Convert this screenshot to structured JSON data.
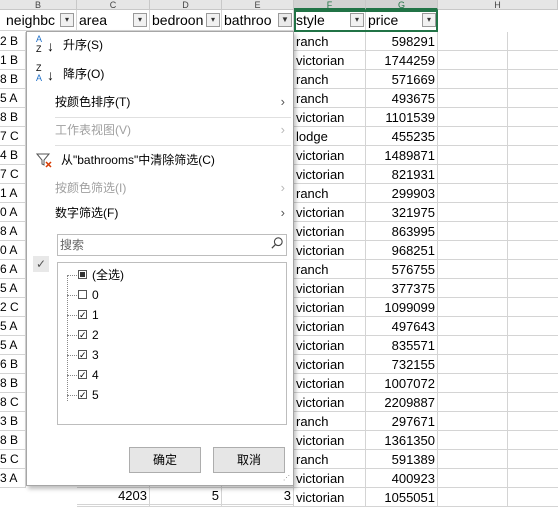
{
  "column_letters": [
    "B",
    "C",
    "D",
    "E",
    "F",
    "G",
    "H"
  ],
  "headers": {
    "neighborhood": "neighbc",
    "area": "area",
    "bedrooms": "bedroon",
    "bathrooms": "bathroo",
    "style": "style",
    "price": "price"
  },
  "row_labels": [
    "2 B",
    "1 B",
    "8 B",
    "5 A",
    "8 B",
    "7 C",
    "4 B",
    "7 C",
    "1 A",
    "0 A",
    "8 A",
    "0 A",
    "6 A",
    "5 A",
    "2 C",
    "5 A",
    "5 A",
    "6 B",
    "8 B",
    "8 C",
    "3 B",
    "8 B",
    "5 C",
    "3 A"
  ],
  "styles": [
    "ranch",
    "victorian",
    "ranch",
    "ranch",
    "victorian",
    "lodge",
    "victorian",
    "victorian",
    "ranch",
    "victorian",
    "victorian",
    "victorian",
    "ranch",
    "victorian",
    "victorian",
    "victorian",
    "victorian",
    "victorian",
    "victorian",
    "victorian",
    "ranch",
    "victorian",
    "ranch",
    "victorian",
    "victorian"
  ],
  "prices": [
    "598291",
    "1744259",
    "571669",
    "493675",
    "1101539",
    "455235",
    "1489871",
    "821931",
    "299903",
    "321975",
    "863995",
    "968251",
    "576755",
    "377375",
    "1099099",
    "497643",
    "835571",
    "732155",
    "1007072",
    "2209887",
    "297671",
    "1361350",
    "591389",
    "400923",
    "1055051"
  ],
  "last_row": {
    "area": "4203",
    "bedrooms": "5",
    "bathrooms": "3"
  },
  "menu": {
    "sort_asc": "升序(S)",
    "sort_desc": "降序(O)",
    "sort_by_color": "按颜色排序(T)",
    "sheet_view": "工作表视图(V)",
    "clear_filter": "从\"bathrooms\"中清除筛选(C)",
    "filter_by_color": "按颜色筛选(I)",
    "number_filters": "数字筛选(F)",
    "search_placeholder": "搜索",
    "select_all": "(全选)",
    "values": [
      {
        "label": "0",
        "checked": false
      },
      {
        "label": "1",
        "checked": true
      },
      {
        "label": "2",
        "checked": true
      },
      {
        "label": "3",
        "checked": true
      },
      {
        "label": "4",
        "checked": true
      },
      {
        "label": "5",
        "checked": true
      }
    ],
    "ok": "确定",
    "cancel": "取消"
  },
  "colors": {
    "selected_column": "#217346",
    "accent_blue": "#1e6fc8",
    "clear_red": "#d83b01"
  }
}
